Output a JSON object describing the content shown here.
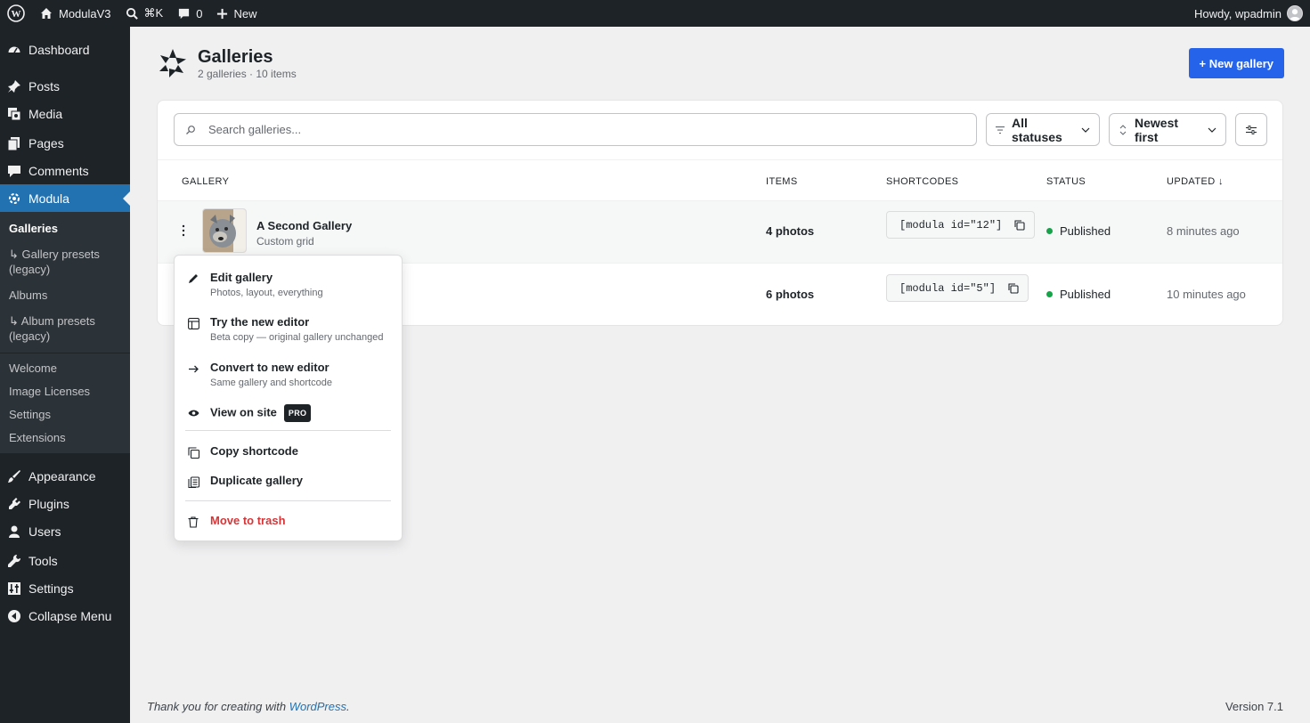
{
  "adminbar": {
    "site_name": "ModulaV3",
    "search_shortcut": "⌘K",
    "comments_count": "0",
    "new_label": "New",
    "howdy": "Howdy, wpadmin"
  },
  "sidebar": {
    "dashboard": "Dashboard",
    "posts": "Posts",
    "media": "Media",
    "pages": "Pages",
    "comments": "Comments",
    "modula": "Modula",
    "modula_sub": {
      "galleries": "Galleries",
      "gallery_presets": "↳ Gallery presets (legacy)",
      "albums": "Albums",
      "album_presets": "↳ Album presets (legacy)"
    },
    "modula_sub2": {
      "welcome": "Welcome",
      "image_licenses": "Image Licenses",
      "settings": "Settings",
      "extensions": "Extensions"
    },
    "appearance": "Appearance",
    "plugins": "Plugins",
    "users": "Users",
    "tools": "Tools",
    "settings": "Settings",
    "collapse": "Collapse Menu"
  },
  "page": {
    "title": "Galleries",
    "subtitle": "2 galleries · 10 items",
    "new_button": "+ New gallery"
  },
  "toolbar": {
    "search_placeholder": "Search galleries...",
    "status_filter": "All statuses",
    "sort": "Newest first"
  },
  "table": {
    "headers": {
      "gallery": "GALLERY",
      "items": "ITEMS",
      "shortcodes": "SHORTCODES",
      "status": "STATUS",
      "updated": "UPDATED ↓"
    },
    "rows": [
      {
        "name": "A Second Gallery",
        "type": "Custom grid",
        "items": "4 photos",
        "shortcode": "[modula id=\"12\"]",
        "status": "Published",
        "updated": "8 minutes ago"
      },
      {
        "name": "",
        "type": "",
        "items": "6 photos",
        "shortcode": "[modula id=\"5\"]",
        "status": "Published",
        "updated": "10 minutes ago"
      }
    ]
  },
  "dropdown": {
    "edit_title": "Edit gallery",
    "edit_desc": "Photos, layout, everything",
    "try_title": "Try the new editor",
    "try_desc": "Beta copy — original gallery unchanged",
    "convert_title": "Convert to new editor",
    "convert_desc": "Same gallery and shortcode",
    "view_title": "View on site",
    "pro_badge": "PRO",
    "copy_title": "Copy shortcode",
    "duplicate_title": "Duplicate gallery",
    "trash_title": "Move to trash"
  },
  "footer": {
    "thanks_prefix": "Thank you for creating with ",
    "wordpress_link": "WordPress",
    "thanks_suffix": ".",
    "version": "Version 7.1"
  },
  "colors": {
    "accent": "#2563eb",
    "sidebar_bg": "#1d2327",
    "active_menu": "#2271b1",
    "status_published": "#16a34a",
    "danger": "#d63638"
  }
}
